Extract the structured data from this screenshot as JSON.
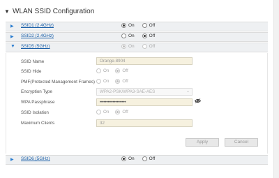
{
  "section": {
    "title": "WLAN SSID Configuration",
    "collapse_icon": "triangle-down-icon"
  },
  "radio_labels": {
    "on": "On",
    "off": "Off"
  },
  "ssids": [
    {
      "label": "SSID1 (2.4GHz)",
      "state": "On",
      "expanded": false
    },
    {
      "label": "SSID2 (2.4GHz)",
      "state": "Off",
      "expanded": false
    },
    {
      "label": "SSID5 (5GHz)",
      "state": "On",
      "expanded": true
    },
    {
      "label": "SSID6 (5GHz)",
      "state": "On",
      "expanded": false
    }
  ],
  "ssid5_details": {
    "ssid_name": {
      "label": "SSID Name",
      "value": "Orange-8904"
    },
    "ssid_hide": {
      "label": "SSID Hide",
      "selected": "Off"
    },
    "pmf": {
      "label": "PMF(Protected Management Frames)",
      "selected": "Off"
    },
    "encryption": {
      "label": "Encryption Type",
      "value": "WPA2-PSK/WPA3-SAE-AES"
    },
    "passphrase": {
      "label": "WPA Passphrase",
      "value": "••••••••••••••••••••",
      "icon": "eye-toggle-icon"
    },
    "isolation": {
      "label": "SSID Isolation",
      "selected": "Off"
    },
    "max_clients": {
      "label": "Maximum Clients",
      "value": "32"
    }
  },
  "buttons": {
    "apply": "Apply",
    "cancel": "Cancel"
  },
  "colors": {
    "link": "#1a5fa8",
    "arrow": "#2a7ccf",
    "input_bg": "#f6f1df",
    "bar_bg": "#eef0f2"
  }
}
